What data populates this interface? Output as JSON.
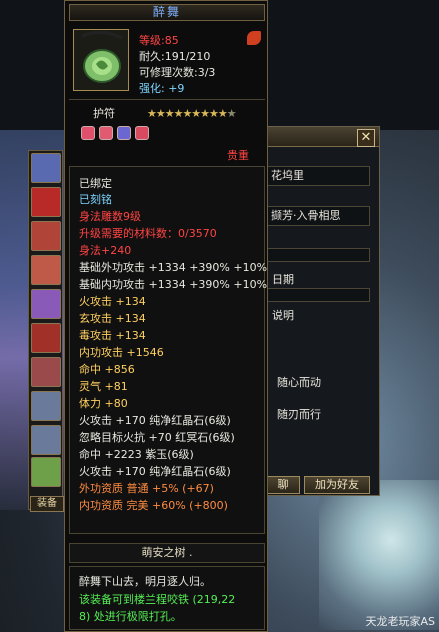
{
  "tooltip": {
    "title": "醉舞",
    "level": "等级:85",
    "durability": "耐久:191/210",
    "repairs": "可修理次数:3/3",
    "enhance": "强化: +9",
    "item_type": "护符",
    "rarity": "贵重",
    "lines": [
      {
        "text": "已绑定",
        "color": "white"
      },
      {
        "text": "已刻铭",
        "color": "cyan"
      },
      {
        "text": "身法雕数9级",
        "color": "red"
      },
      {
        "text": "升级需要的材料数：0/3570",
        "color": "red"
      },
      {
        "text": "身法+240",
        "color": "red"
      },
      {
        "text": "基础外功攻击 +1334 +390% +10%",
        "color": "white"
      },
      {
        "text": "基础内功攻击 +1334 +390% +10%",
        "color": "white"
      },
      {
        "text": "火攻击 +134",
        "color": "white"
      },
      {
        "text": "玄攻击 +134",
        "color": "white"
      },
      {
        "text": "毒攻击 +134",
        "color": "white"
      },
      {
        "text": "内功攻击 +1546",
        "color": "white"
      },
      {
        "text": "命中 +856",
        "color": "gold"
      },
      {
        "text": "灵气 +81",
        "color": "gold"
      },
      {
        "text": "体力 +80",
        "color": "gold"
      },
      {
        "text": "火攻击 +170 纯净红晶石(6级)",
        "color": "white"
      },
      {
        "text": "忽略目标火抗 +70 红冥石(6级)",
        "color": "white"
      },
      {
        "text": "命中 +2223 紫玉(6级)",
        "color": "white"
      },
      {
        "text": "火攻击 +170 纯净红晶石(6级)",
        "color": "white"
      },
      {
        "text": "外功资质   普通 +5% (+67)",
        "color": "orange"
      },
      {
        "text": "内功资质   完美 +60% (+800)",
        "color": "orange"
      }
    ],
    "footer_title": "萌安之树 .",
    "flavor": "醉舞下山去，明月逐人归。",
    "hint1": "该装备可到楼兰程咬铁 (219,22",
    "hint2": "8) 处进行极限打孔。"
  },
  "right_panel": {
    "close": "✕",
    "field1": "花坞里",
    "field2": "撷芳·入骨相思",
    "label_date": "日期",
    "label_desc": "说明",
    "text1": "随心而动",
    "text2": "随刃而行",
    "btn_left": "聊",
    "btn_add": "加为好友"
  },
  "equip_tab": "装备",
  "watermark": "天龙老玩家AS",
  "colors": {
    "red": "#ff4444",
    "white": "#e8e8e0",
    "cyan": "#7fd4ff",
    "green": "#55ee55",
    "gold": "#ffd060",
    "orange": "#ff8c40"
  }
}
